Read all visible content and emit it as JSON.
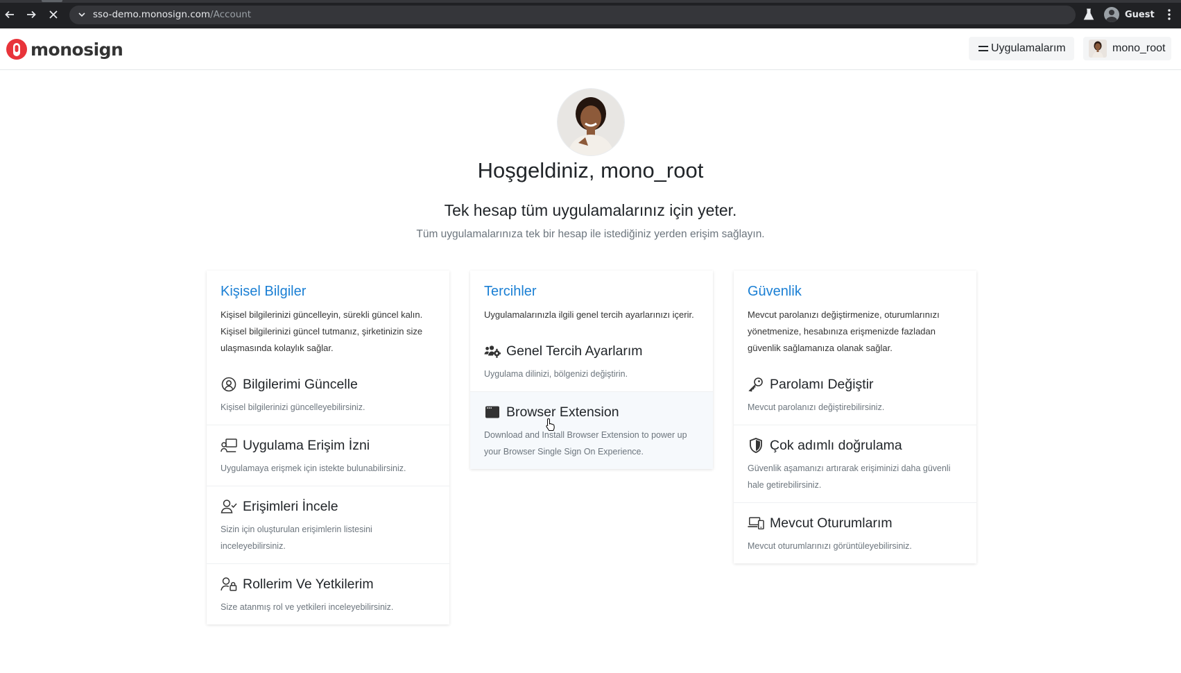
{
  "browser": {
    "url_host": "sso-demo.monosign.com",
    "url_path": "/Account",
    "profile_label": "Guest",
    "icons": [
      "back-icon",
      "forward-icon",
      "stop-icon",
      "chevron-down-icon",
      "labs-icon",
      "profile-icon",
      "kebab-menu-icon"
    ]
  },
  "header": {
    "logo_text": "monosign",
    "apps_label": "Uygulamalarım",
    "user_label": "mono_root",
    "brand_color": "#e8343a"
  },
  "hero": {
    "welcome": "Hoşgeldiniz, mono_root",
    "tagline": "Tek hesap tüm uygulamalarınız için yeter.",
    "subline": "Tüm uygulamalarınıza tek bir hesap ile istediğiniz yerden erişim sağlayın."
  },
  "cards": {
    "personal": {
      "title": "Kişisel Bilgiler",
      "desc": "Kişisel bilgilerinizi güncelleyin, sürekli güncel kalın. Kişisel bilgilerinizi güncel tutmanız, şirketinizin size ulaşmasında kolaylık sağlar.",
      "items": [
        {
          "title": "Bilgilerimi Güncelle",
          "desc": "Kişisel bilgilerinizi güncelleyebilirsiniz.",
          "icon": "user-circle-icon"
        },
        {
          "title": "Uygulama Erişim İzni",
          "desc": "Uygulamaya erişmek için istekte bulunabilirsiniz.",
          "icon": "app-access-icon"
        },
        {
          "title": "Erişimleri İncele",
          "desc": "Sizin için oluşturulan erişimlerin listesini inceleyebilirsiniz.",
          "icon": "user-check-icon"
        },
        {
          "title": "Rollerim Ve Yetkilerim",
          "desc": "Size atanmış rol ve yetkileri inceleyebilirsiniz.",
          "icon": "user-lock-icon"
        }
      ]
    },
    "preferences": {
      "title": "Tercihler",
      "desc": "Uygulamalarınızla ilgili genel tercih ayarlarınızı içerir.",
      "items": [
        {
          "title": "Genel Tercih Ayarlarım",
          "desc": "Uygulama dilinizi, bölgenizi değiştirin.",
          "icon": "users-cog-icon"
        },
        {
          "title": "Browser Extension",
          "desc": "Download and Install Browser Extension to power up your Browser Single Sign On Experience.",
          "icon": "browser-window-icon"
        }
      ]
    },
    "security": {
      "title": "Güvenlik",
      "desc": "Mevcut parolanızı değiştirmenize, oturumlarınızı yönetmenize, hesabınıza erişmenizde fazladan güvenlik sağlamanıza olanak sağlar.",
      "items": [
        {
          "title": "Parolamı Değiştir",
          "desc": "Mevcut parolanızı değiştirebilirsiniz.",
          "icon": "key-icon"
        },
        {
          "title": "Çok adımlı doğrulama",
          "desc": "Güvenlik aşamanızı artırarak erişiminizi daha güvenli hale getirebilirsiniz.",
          "icon": "shield-icon"
        },
        {
          "title": "Mevcut Oturumlarım",
          "desc": "Mevcut oturumlarınızı görüntüleyebilirsiniz.",
          "icon": "devices-icon"
        }
      ]
    }
  }
}
